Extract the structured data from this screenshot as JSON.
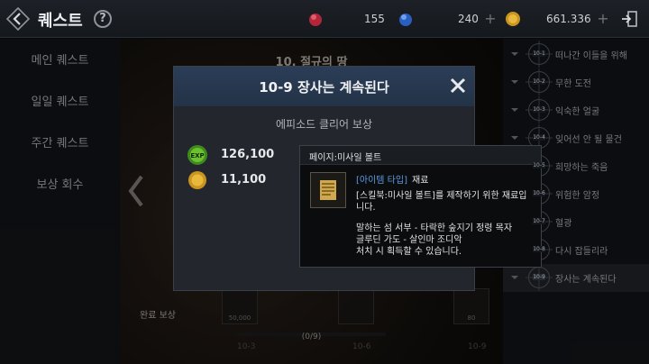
{
  "header": {
    "title": "퀘스트",
    "help_glyph": "?",
    "currencies": [
      {
        "icon": "red-gem-icon",
        "value": ""
      },
      {
        "icon": "blue-gem-icon",
        "value": "155"
      },
      {
        "icon": "plus-icon",
        "value": "240"
      },
      {
        "icon": "gold-coin-icon",
        "value": "661.336"
      }
    ],
    "plus_glyph": "+"
  },
  "left_menu": {
    "items": [
      "메인 퀘스트",
      "일일 퀘스트",
      "주간 퀘스트",
      "보상 회수"
    ]
  },
  "center": {
    "chapter_title": "10. 절규의 땅",
    "nodes": [
      "10-9",
      "10-8"
    ],
    "reward_label": "완료 보상",
    "reward_boxes": [
      {
        "value": "50,000"
      },
      {
        "value": ""
      },
      {
        "value": "80"
      }
    ],
    "progress_text": "(0/9)",
    "progress": 0,
    "ticks": [
      "10-3",
      "10-6",
      "10-9"
    ]
  },
  "quest_list": [
    {
      "id": "10-1",
      "name": "떠나간 이들을 위해"
    },
    {
      "id": "10-2",
      "name": "무한 도전"
    },
    {
      "id": "10-3",
      "name": "익숙한 얼굴"
    },
    {
      "id": "10-4",
      "name": "잊어선 안 될 물건"
    },
    {
      "id": "10-5",
      "name": "희망하는 죽음"
    },
    {
      "id": "10-6",
      "name": "위험한 암정"
    },
    {
      "id": "10-7",
      "name": "혈광"
    },
    {
      "id": "10-8",
      "name": "다시 잡들리라"
    },
    {
      "id": "10-9",
      "name": "장사는 계속된다"
    }
  ],
  "modal": {
    "title": "10-9 장사는 계속된다",
    "subtitle": "에피소드 클리어 보상",
    "rewards": [
      {
        "icon": "exp-icon",
        "label": "EXP",
        "value": "126,100"
      },
      {
        "icon": "gold-coin-icon",
        "value": "11,100"
      }
    ]
  },
  "tooltip": {
    "title": "페이지:미사일 볼트",
    "type_label": "[아이템 타입]",
    "type_value": "재료",
    "description": "[스킬북:미사일 볼트]를 제작하기 위한 재료입니다.",
    "location": "말하는 섬 서부 - 타락한 숲지기 정령 목자\n글루딘 가도 - 살인마 조디악\n처치 시 획득할 수 있습니다."
  },
  "colors": {
    "accent_blue": "#5d9be0",
    "header_blue": "#2b3d57",
    "active_row": "#262a30"
  }
}
